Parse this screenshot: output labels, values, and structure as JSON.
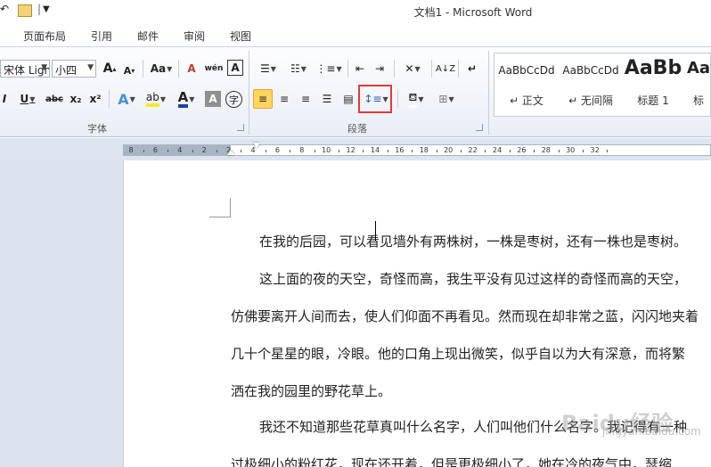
{
  "window": {
    "title": "文档1 - Microsoft Word"
  },
  "tabs": [
    "页面布局",
    "引用",
    "邮件",
    "审阅",
    "视图"
  ],
  "ribbon": {
    "font": {
      "font_name": "宋体 Ligh",
      "font_size": "小四",
      "grow_font": "A",
      "shrink_font": "A",
      "change_case": "Aa",
      "clear_format": "A",
      "phonetic": "wén",
      "char_border": "A",
      "underline": "U",
      "strike": "abc",
      "subscript": "x₂",
      "superscript": "x²",
      "effects": "A",
      "font_color": "A",
      "shading": "A",
      "enclose": "字",
      "group_label": "字体"
    },
    "paragraph": {
      "group_label": "段落"
    },
    "styles": [
      {
        "sample": "AaBbCcDd",
        "name": "↵ 正文"
      },
      {
        "sample": "AaBbCcDd",
        "name": "↵ 无间隔"
      },
      {
        "sample": "AaBb",
        "name": "标题 1"
      },
      {
        "sample": "Aa",
        "name": "标"
      }
    ]
  },
  "ruler": {
    "labels": [
      "8",
      "6",
      "4",
      "2",
      "2",
      "4",
      "6",
      "8",
      "10",
      "12",
      "14",
      "16",
      "18",
      "20",
      "22",
      "24",
      "26",
      "28",
      "30",
      "32"
    ]
  },
  "document": {
    "paragraphs": [
      "在我的后园，可以看见墙外有两株树，一株是枣树，还有一株也是枣树。",
      "这上面的夜的天空，奇怪而高，我生平没有见过这样的奇怪而高的天空，",
      "仿佛要离开人间而去，使人们仰面不再看见。然而现在却非常之蓝，闪闪地夹着",
      "几十个星星的眼，冷眼。他的口角上现出微笑，似乎自以为大有深意，而将繁",
      "洒在我的园里的野花草上。",
      "我还不知道那些花草真叫什么名字，人们叫他们什么名字。我记得有一种",
      "过极细小的粉红花，现在还开着，但是更极细小了，她在冷的夜气中，瑟缩"
    ]
  },
  "watermark": {
    "text": "Baidu经验",
    "url": "jingyan.baidu.com"
  }
}
